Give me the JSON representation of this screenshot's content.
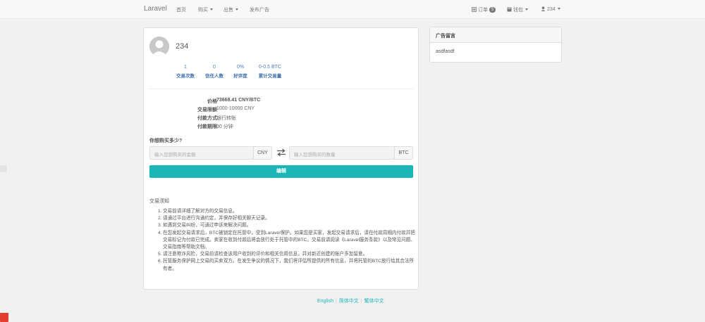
{
  "navbar": {
    "brand": "Laravel",
    "links": [
      "首页",
      "购买",
      "出售",
      "发布广告"
    ],
    "orders_label": "订单",
    "orders_count": "5",
    "wallet_label": "钱包",
    "user_label": "234"
  },
  "profile": {
    "username": "234",
    "stats": [
      {
        "value": "1",
        "label": "交易次数"
      },
      {
        "value": "0",
        "label": "信任人数"
      },
      {
        "value": "0%",
        "label": "好评度"
      },
      {
        "value": "0-0.5 BTC",
        "label": "累计交易量"
      }
    ]
  },
  "ad_info": {
    "rows": [
      {
        "label": "价格",
        "value": "73668.41 CNY/BTC"
      },
      {
        "label": "交易限额",
        "value": "1000-10000 CNY"
      },
      {
        "label": "付款方式",
        "value": "银行转账"
      },
      {
        "label": "付款期限",
        "value": "30 分钟"
      }
    ]
  },
  "trade_form": {
    "question": "你想购买多少?",
    "amount_placeholder": "输入您想购买的金额",
    "amount_currency": "CNY",
    "qty_placeholder": "输入您想购买的数量",
    "qty_currency": "BTC",
    "edit_button": "编辑"
  },
  "notice": {
    "title": "交易须知",
    "items": [
      "交易前请详细了解对方的交易信息。",
      "请通过平台进行沟通约定，并保存好相关聊天记录。",
      "如遇到交易纠纷，可通过申诉来解决问题。",
      "在您发起交易请求后，BTC被锁定在托管中，受到Laravel保护。如果您是买家，发起交易请求后，请在付款周期内付款并把交易标记为付款已完成。卖家在收到付款后将会放行处于托管中的BTC。交易前请阅读《Laravel服务条款》以及常见问题、交易指南等帮助文档。",
      "请注意欺诈风险，交易前请检查该用户收到的评价和相关信用信息，并对新近创建的账户多加留意。",
      "托管服务保护网上交易的买卖双方。在发生争议的情况下，我们将评估所提供的所有信息，并将托管的BTC放行给其合法所有者。"
    ]
  },
  "side_panel": {
    "title": "广告留言",
    "message": "asdfasdf"
  },
  "footer": {
    "languages": [
      "English",
      "简体中文",
      "繁体中文"
    ]
  },
  "colors": {
    "accent": "#1bb7b7",
    "stat_blue": "#3a6db0",
    "navbar_bg": "#f8f8f8",
    "page_bg": "#f1f1f1"
  }
}
